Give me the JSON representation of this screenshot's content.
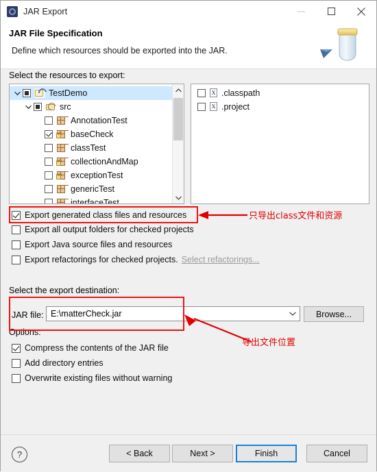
{
  "window": {
    "title": "JAR Export",
    "app_icon": "jar-export-icon",
    "controls": {
      "minimize": "minimize-icon",
      "maximize": "maximize-icon",
      "close": "close-icon"
    }
  },
  "header": {
    "title": "JAR File Specification",
    "subtitle": "Define which resources should be exported into the JAR.",
    "art": "jar-jar-with-arrow-icon"
  },
  "resources": {
    "label": "Select the resources to export:",
    "tree": [
      {
        "label": "TestDemo",
        "icon": "java-project-icon",
        "indent": 0,
        "twisty": "expanded",
        "check": "partial",
        "selected": true
      },
      {
        "label": "src",
        "icon": "source-folder-icon",
        "indent": 1,
        "twisty": "expanded",
        "check": "partial",
        "selected": false
      },
      {
        "label": "AnnotationTest",
        "icon": "package-icon",
        "indent": 2,
        "twisty": "none",
        "check": "unchecked",
        "selected": false
      },
      {
        "label": "baseCheck",
        "icon": "package-locked-icon",
        "indent": 2,
        "twisty": "none",
        "check": "checked",
        "selected": false
      },
      {
        "label": "classTest",
        "icon": "package-icon",
        "indent": 2,
        "twisty": "none",
        "check": "unchecked",
        "selected": false
      },
      {
        "label": "collectionAndMap",
        "icon": "package-locked-icon",
        "indent": 2,
        "twisty": "none",
        "check": "unchecked",
        "selected": false
      },
      {
        "label": "exceptionTest",
        "icon": "package-locked-icon",
        "indent": 2,
        "twisty": "none",
        "check": "unchecked",
        "selected": false
      },
      {
        "label": "genericTest",
        "icon": "package-icon",
        "indent": 2,
        "twisty": "none",
        "check": "unchecked",
        "selected": false
      },
      {
        "label": "interfaceTest",
        "icon": "package-icon",
        "indent": 2,
        "twisty": "none",
        "check": "unchecked",
        "selected": false
      }
    ],
    "files": [
      {
        "label": ".classpath",
        "icon": "xml-file-icon",
        "badge": "X",
        "check": "unchecked"
      },
      {
        "label": ".project",
        "icon": "xml-file-icon",
        "badge": "X",
        "check": "unchecked"
      }
    ],
    "scrollbar": {
      "up": "chevron-up-icon",
      "down": "chevron-down-icon"
    }
  },
  "options_export": [
    {
      "label": "Export generated class files and resources",
      "checked": true
    },
    {
      "label": "Export all output folders for checked projects",
      "checked": false
    },
    {
      "label": "Export Java source files and resources",
      "checked": false
    },
    {
      "label": "Export refactorings for checked projects.",
      "checked": false,
      "link": "Select refactorings..."
    }
  ],
  "destination": {
    "label": "Select the export destination:",
    "field_label": "JAR file:",
    "value": "E:\\matterCheck.jar",
    "placeholder": "",
    "dropdown_icon": "chevron-down-icon",
    "browse_label": "Browse..."
  },
  "options": {
    "label": "Options:",
    "items": [
      {
        "label": "Compress the contents of the JAR file",
        "checked": true
      },
      {
        "label": "Add directory entries",
        "checked": false
      },
      {
        "label": "Overwrite existing files without warning",
        "checked": false
      }
    ]
  },
  "annotations": {
    "color": "#e00000",
    "note1": "只导出class文件和资源",
    "note2": "导出文件位置"
  },
  "footer": {
    "help_icon": "help-icon",
    "back": "< Back",
    "next": "Next >",
    "finish": "Finish",
    "cancel": "Cancel"
  }
}
